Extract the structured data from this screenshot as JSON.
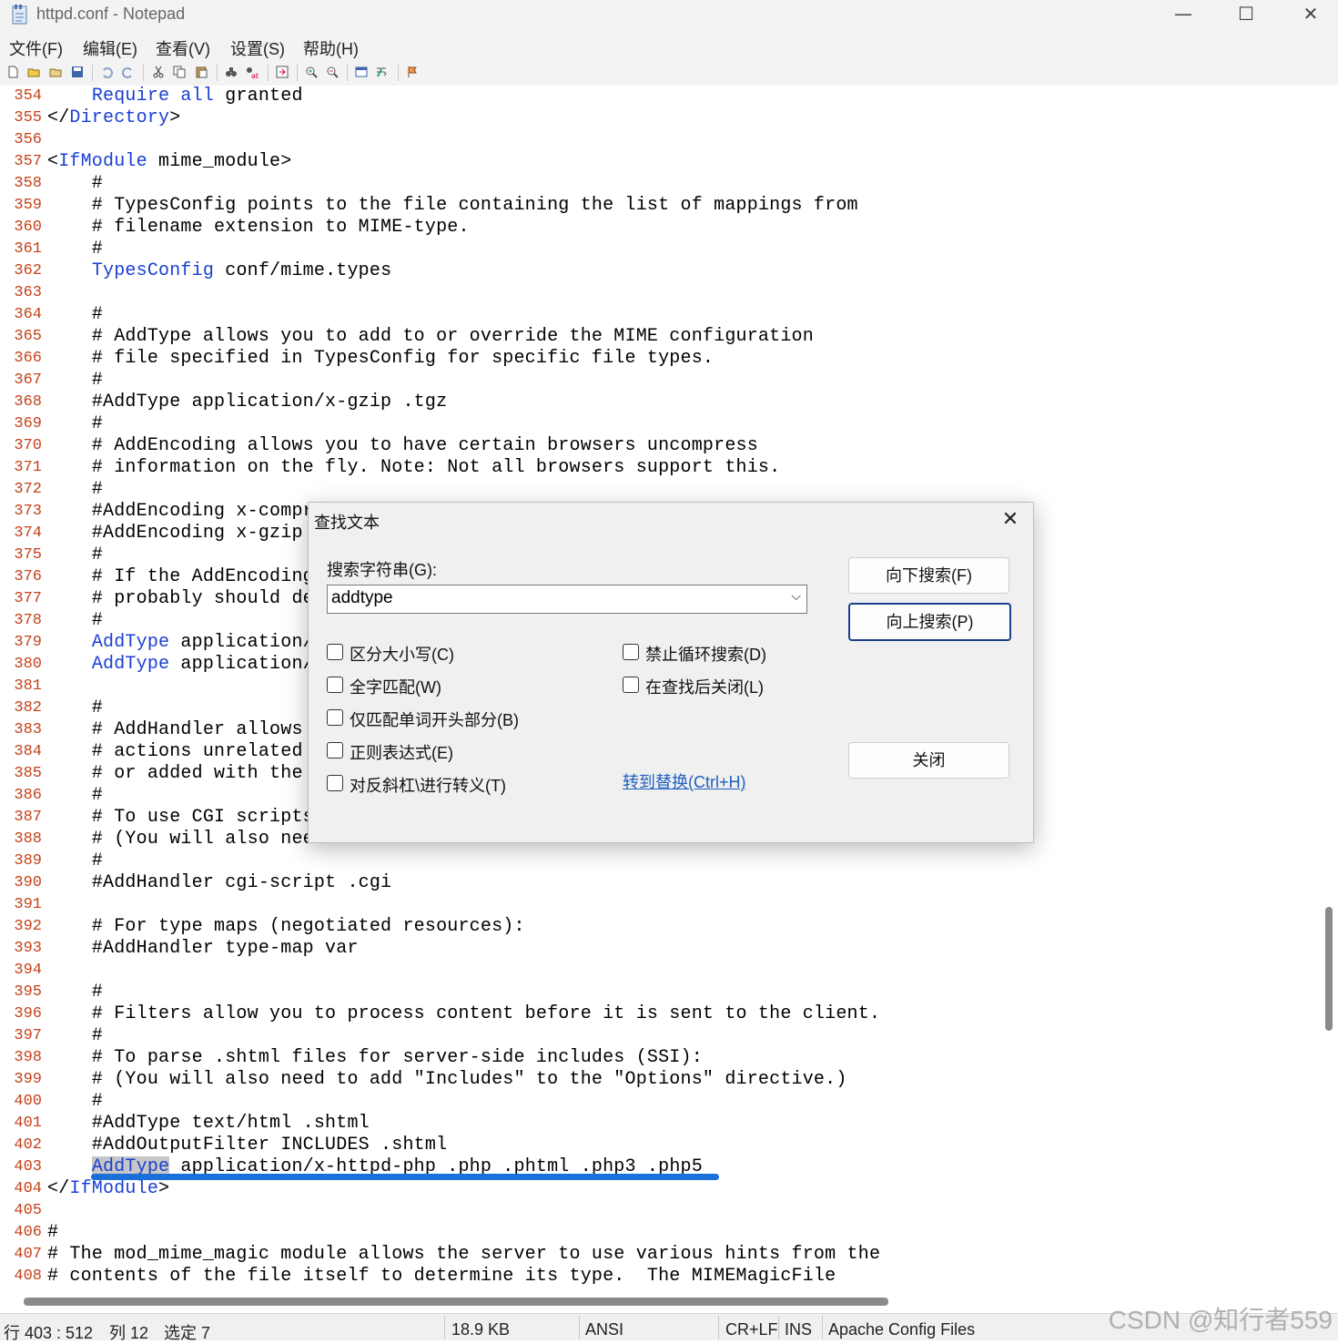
{
  "window": {
    "title": "httpd.conf - Notepad",
    "minimize_glyph": "—",
    "maximize_glyph": "☐",
    "close_glyph": "✕"
  },
  "menu": [
    "文件(F)",
    "编辑(E)",
    "查看(V)",
    "设置(S)",
    "帮助(H)"
  ],
  "editor": {
    "selected_text": "AddType",
    "lines": [
      {
        "n": "354",
        "segs": [
          {
            "t": "    "
          },
          {
            "t": "Require all",
            "k": "kw"
          },
          {
            "t": " granted"
          }
        ]
      },
      {
        "n": "355",
        "segs": [
          {
            "t": "</"
          },
          {
            "t": "Directory",
            "k": "kw"
          },
          {
            "t": ">"
          }
        ]
      },
      {
        "n": "356",
        "segs": []
      },
      {
        "n": "357",
        "segs": [
          {
            "t": "<"
          },
          {
            "t": "IfModule",
            "k": "kw"
          },
          {
            "t": " mime_module>"
          }
        ]
      },
      {
        "n": "358",
        "segs": [
          {
            "t": "    #"
          }
        ]
      },
      {
        "n": "359",
        "segs": [
          {
            "t": "    # TypesConfig points to the file containing the list of mappings from"
          }
        ]
      },
      {
        "n": "360",
        "segs": [
          {
            "t": "    # filename extension to MIME-type."
          }
        ]
      },
      {
        "n": "361",
        "segs": [
          {
            "t": "    #"
          }
        ]
      },
      {
        "n": "362",
        "segs": [
          {
            "t": "    "
          },
          {
            "t": "TypesConfig",
            "k": "kw"
          },
          {
            "t": " conf/mime.types"
          }
        ]
      },
      {
        "n": "363",
        "segs": []
      },
      {
        "n": "364",
        "segs": [
          {
            "t": "    #"
          }
        ]
      },
      {
        "n": "365",
        "segs": [
          {
            "t": "    # AddType allows you to add to or override the MIME configuration"
          }
        ]
      },
      {
        "n": "366",
        "segs": [
          {
            "t": "    # file specified in TypesConfig for specific file types."
          }
        ]
      },
      {
        "n": "367",
        "segs": [
          {
            "t": "    #"
          }
        ]
      },
      {
        "n": "368",
        "segs": [
          {
            "t": "    #AddType application/x-gzip .tgz"
          }
        ]
      },
      {
        "n": "369",
        "segs": [
          {
            "t": "    #"
          }
        ]
      },
      {
        "n": "370",
        "segs": [
          {
            "t": "    # AddEncoding allows you to have certain browsers uncompress"
          }
        ]
      },
      {
        "n": "371",
        "segs": [
          {
            "t": "    # information on the fly. Note: Not all browsers support this."
          }
        ]
      },
      {
        "n": "372",
        "segs": [
          {
            "t": "    #"
          }
        ]
      },
      {
        "n": "373",
        "segs": [
          {
            "t": "    #AddEncoding x-compr"
          }
        ]
      },
      {
        "n": "374",
        "segs": [
          {
            "t": "    #AddEncoding x-gzip "
          }
        ]
      },
      {
        "n": "375",
        "segs": [
          {
            "t": "    #"
          }
        ]
      },
      {
        "n": "376",
        "segs": [
          {
            "t": "    # If the AddEncoding"
          }
        ]
      },
      {
        "n": "377",
        "segs": [
          {
            "t": "    # probably should de"
          }
        ]
      },
      {
        "n": "378",
        "segs": [
          {
            "t": "    #"
          }
        ]
      },
      {
        "n": "379",
        "segs": [
          {
            "t": "    "
          },
          {
            "t": "AddType",
            "k": "kw"
          },
          {
            "t": " application/"
          }
        ]
      },
      {
        "n": "380",
        "segs": [
          {
            "t": "    "
          },
          {
            "t": "AddType",
            "k": "kw"
          },
          {
            "t": " application/"
          }
        ]
      },
      {
        "n": "381",
        "segs": []
      },
      {
        "n": "382",
        "segs": [
          {
            "t": "    #"
          }
        ]
      },
      {
        "n": "383",
        "segs": [
          {
            "t": "    # AddHandler allows "
          }
        ]
      },
      {
        "n": "384",
        "segs": [
          {
            "t": "    # actions unrelated "
          }
        ]
      },
      {
        "n": "385",
        "segs": [
          {
            "t": "    # or added with the "
          }
        ]
      },
      {
        "n": "386",
        "segs": [
          {
            "t": "    #"
          }
        ]
      },
      {
        "n": "387",
        "segs": [
          {
            "t": "    # To use CGI scripts"
          }
        ]
      },
      {
        "n": "388",
        "segs": [
          {
            "t": "    # (You will also nee"
          }
        ]
      },
      {
        "n": "389",
        "segs": [
          {
            "t": "    #"
          }
        ]
      },
      {
        "n": "390",
        "segs": [
          {
            "t": "    #AddHandler cgi-script .cgi"
          }
        ]
      },
      {
        "n": "391",
        "segs": []
      },
      {
        "n": "392",
        "segs": [
          {
            "t": "    # For type maps (negotiated resources):"
          }
        ]
      },
      {
        "n": "393",
        "segs": [
          {
            "t": "    #AddHandler type-map var"
          }
        ]
      },
      {
        "n": "394",
        "segs": []
      },
      {
        "n": "395",
        "segs": [
          {
            "t": "    #"
          }
        ]
      },
      {
        "n": "396",
        "segs": [
          {
            "t": "    # Filters allow you to process content before it is sent to the client."
          }
        ]
      },
      {
        "n": "397",
        "segs": [
          {
            "t": "    #"
          }
        ]
      },
      {
        "n": "398",
        "segs": [
          {
            "t": "    # To parse .shtml files for server-side includes (SSI):"
          }
        ]
      },
      {
        "n": "399",
        "segs": [
          {
            "t": "    # (You will also need to add \"Includes\" to the \"Options\" directive.)"
          }
        ]
      },
      {
        "n": "400",
        "segs": [
          {
            "t": "    #"
          }
        ]
      },
      {
        "n": "401",
        "segs": [
          {
            "t": "    #AddType text/html .shtml"
          }
        ]
      },
      {
        "n": "402",
        "segs": [
          {
            "t": "    #AddOutputFilter INCLUDES .shtml"
          }
        ]
      },
      {
        "n": "403",
        "segs": [
          {
            "t": "    "
          },
          {
            "t": "AddType",
            "k": "kw sel"
          },
          {
            "t": " application/x-httpd-php .php .phtml .php3 .php5"
          }
        ]
      },
      {
        "n": "404",
        "segs": [
          {
            "t": "</"
          },
          {
            "t": "IfModule",
            "k": "kw"
          },
          {
            "t": ">"
          }
        ]
      },
      {
        "n": "405",
        "segs": []
      },
      {
        "n": "406",
        "segs": [
          {
            "t": "#"
          }
        ]
      },
      {
        "n": "407",
        "segs": [
          {
            "t": "# The mod_mime_magic module allows the server to use various hints from the"
          }
        ]
      },
      {
        "n": "408",
        "segs": [
          {
            "t": "# contents of the file itself to determine its type.  The MIMEMagicFile"
          }
        ]
      }
    ]
  },
  "status": {
    "position": "行 403 : 512",
    "column": "列 12",
    "selection": "选定 7",
    "size": "18.9 KB",
    "encoding": "ANSI",
    "line_ending": "CR+LF",
    "mode": "INS",
    "scheme": "Apache Config Files"
  },
  "watermark": "CSDN @知行者559",
  "find_dialog": {
    "title": "查找文本",
    "close_glyph": "✕",
    "search_label": "搜索字符串(G):",
    "search_value": "addtype",
    "dropdown_glyph": "⌵",
    "options_left": [
      "区分大小写(C)",
      "全字匹配(W)",
      "仅匹配单词开头部分(B)",
      "正则表达式(E)",
      "对反斜杠\\进行转义(T)"
    ],
    "options_right": [
      "禁止循环搜索(D)",
      "在查找后关闭(L)"
    ],
    "find_next": "向下搜索(F)",
    "find_prev": "向上搜索(P)",
    "close_button": "关闭",
    "replace_link": "转到替换(Ctrl+H)"
  },
  "colors": {
    "keyword": "#1a3fd1",
    "line_number": "#c5401a",
    "annotation_stroke": "#1a6fd8"
  }
}
